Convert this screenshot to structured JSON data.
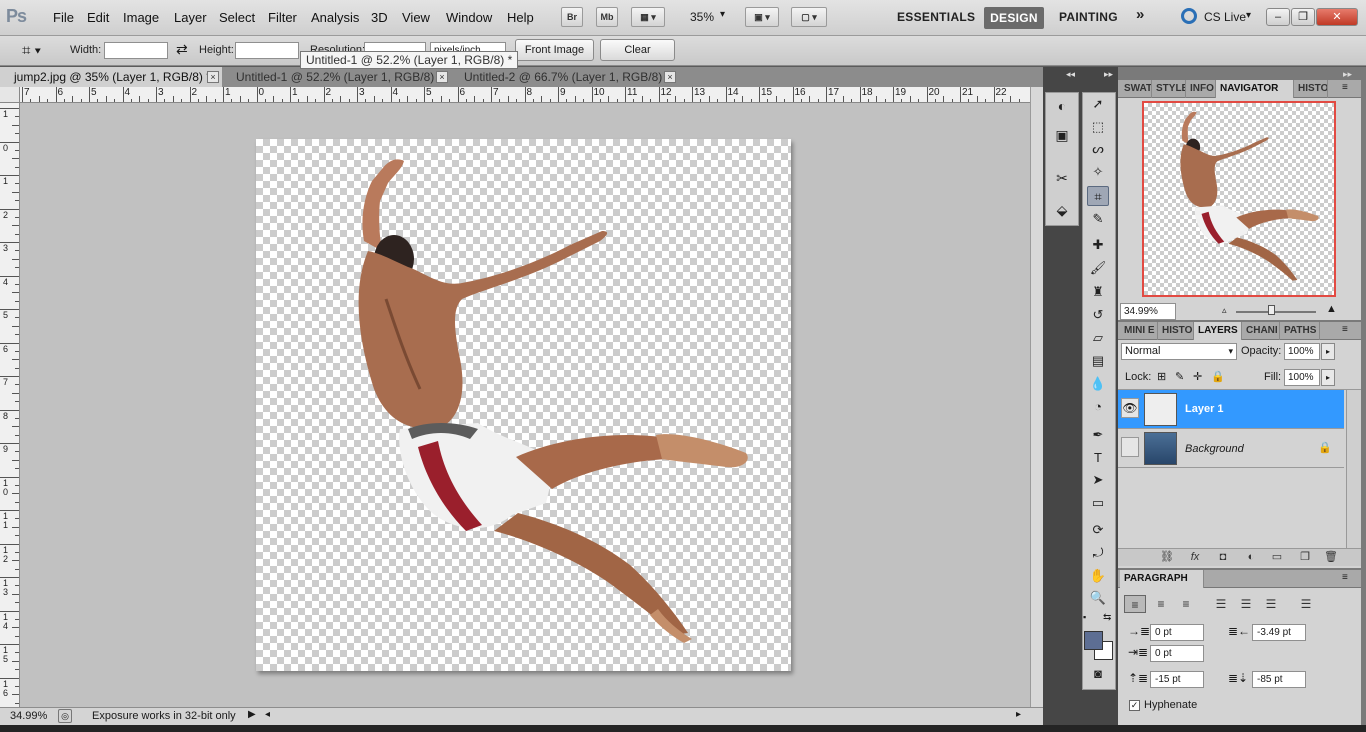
{
  "app": {
    "logo": "Ps"
  },
  "menu": [
    "File",
    "Edit",
    "Image",
    "Layer",
    "Select",
    "Filter",
    "Analysis",
    "3D",
    "View",
    "Window",
    "Help"
  ],
  "appbar": {
    "bridge": "Br",
    "minibridge": "Mb",
    "zoom": "35%"
  },
  "workspaces": {
    "essentials": "ESSENTIALS",
    "design": "DESIGN",
    "painting": "PAINTING",
    "more": "»",
    "cslive": "CS Live"
  },
  "window_controls": {
    "minimize": "–",
    "restore": "❐",
    "close": "✕"
  },
  "options": {
    "width_label": "Width:",
    "width_value": "",
    "swap": "⇄",
    "height_label": "Height:",
    "height_value": "",
    "resolution_label": "Resolution:",
    "unit": "pixels/inch",
    "front_image": "Front Image",
    "clear": "Clear"
  },
  "tooltip": "Untitled-1 @ 52.2% (Layer 1, RGB/8) *",
  "tabs": [
    {
      "label": "jump2.jpg @ 35% (Layer 1, RGB/8) *",
      "close": "×"
    },
    {
      "label": "Untitled-1 @ 52.2% (Layer 1, RGB/8) *",
      "close": "×"
    },
    {
      "label": "Untitled-2 @ 66.7% (Layer 1, RGB/8) *",
      "close": "×"
    }
  ],
  "ruler_h": [
    "7",
    "6",
    "5",
    "4",
    "3",
    "2",
    "1",
    "0",
    "1",
    "2",
    "3",
    "4",
    "5",
    "6",
    "7",
    "8",
    "9",
    "10",
    "11",
    "12",
    "13",
    "14",
    "15",
    "16",
    "17",
    "18",
    "19",
    "20",
    "21",
    "22"
  ],
  "ruler_v": [
    "1",
    "0",
    "1",
    "2",
    "3",
    "4",
    "5",
    "6",
    "7",
    "8",
    "9",
    "1\n0",
    "1\n1",
    "1\n2",
    "1\n3",
    "1\n4",
    "1\n5",
    "1\n6"
  ],
  "status": {
    "zoom": "34.99%",
    "message": "Exposure works in 32-bit only"
  },
  "panels": {
    "top_tabs": [
      "SWAT",
      "STYLE",
      "INFO",
      "NAVIGATOR",
      "HISTO"
    ],
    "navigator_zoom": "34.99%",
    "mid_tabs": [
      "MINI E",
      "HISTO",
      "LAYERS",
      "CHANI",
      "PATHS"
    ],
    "blend_mode": "Normal",
    "opacity_label": "Opacity:",
    "opacity": "100%",
    "lock_label": "Lock:",
    "fill_label": "Fill:",
    "fill": "100%",
    "layers": [
      {
        "name": "Layer 1",
        "selected": true,
        "visible": true
      },
      {
        "name": "Background",
        "selected": false,
        "visible": false,
        "locked": true
      }
    ],
    "paragraph_title": "PARAGRAPH",
    "indent_left": "0 pt",
    "indent_right": "-3.49 pt",
    "indent_first": "0 pt",
    "space_before": "-15 pt",
    "space_after": "-85 pt",
    "hyphenate": "Hyphenate"
  },
  "colors": {
    "accent": "#3399ff",
    "foreground": "#5d6e93",
    "background": "#ffffff",
    "nav_frame": "#e24a42"
  }
}
